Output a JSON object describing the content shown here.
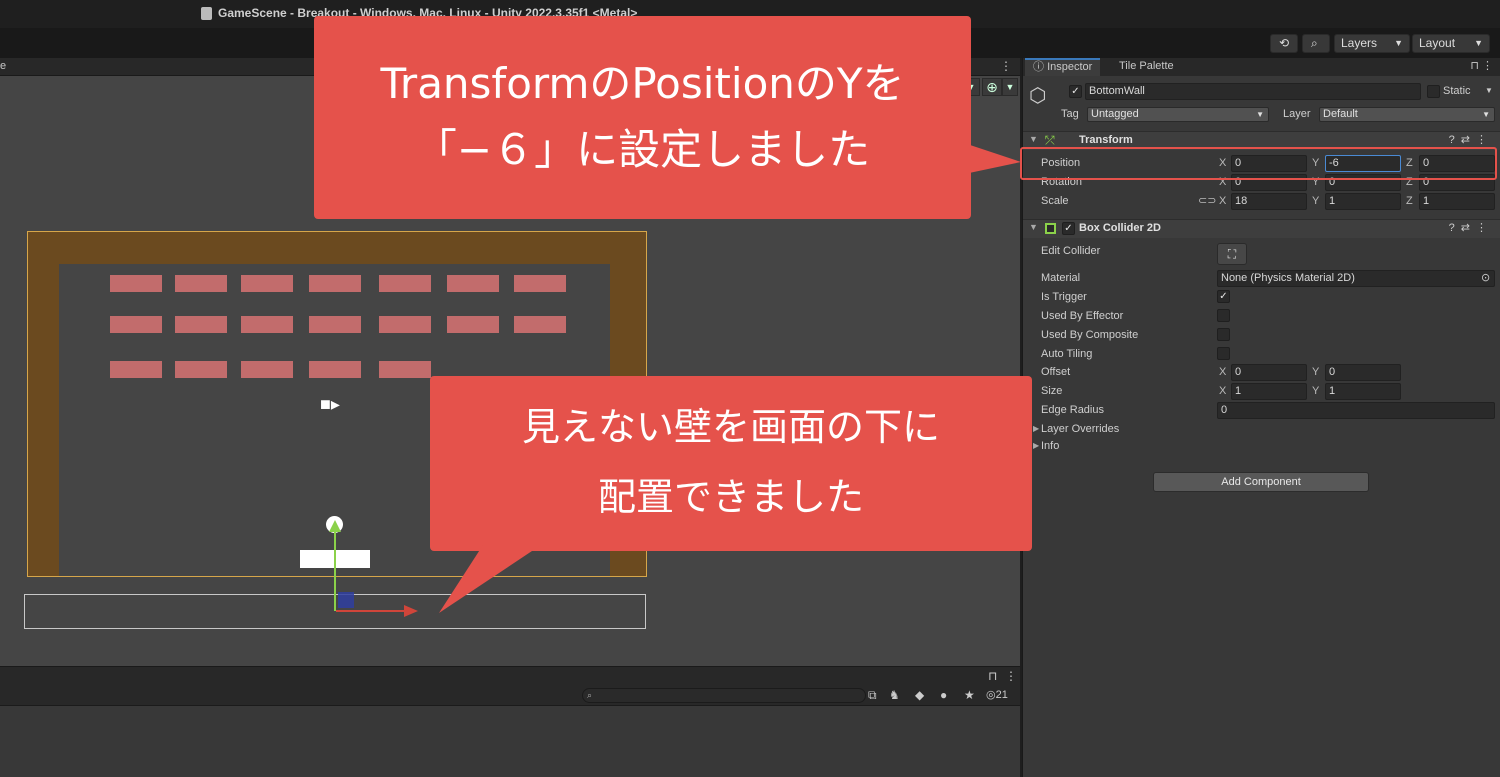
{
  "window": {
    "title": "GameScene - Breakout - Windows, Mac, Linux - Unity 2022.3.35f1 <Metal>"
  },
  "toolbar": {
    "layers_label": "Layers",
    "layout_label": "Layout"
  },
  "scene": {
    "tab_label": "e"
  },
  "inspector": {
    "tabs": [
      "Inspector",
      "Tile Palette"
    ],
    "object_name": "BottomWall",
    "static_label": "Static",
    "tag_label": "Tag",
    "tag_value": "Untagged",
    "layer_label": "Layer",
    "layer_value": "Default",
    "transform": {
      "title": "Transform",
      "position_label": "Position",
      "rotation_label": "Rotation",
      "scale_label": "Scale",
      "position": {
        "x": "0",
        "y": "-6",
        "z": "0"
      },
      "rotation": {
        "x": "0",
        "y": "0",
        "z": "0"
      },
      "scale": {
        "x": "18",
        "y": "1",
        "z": "1"
      }
    },
    "box_collider": {
      "title": "Box Collider 2D",
      "edit_collider": "Edit Collider",
      "material_label": "Material",
      "material_value": "None (Physics Material 2D)",
      "is_trigger": "Is Trigger",
      "used_by_effector": "Used By Effector",
      "used_by_composite": "Used By Composite",
      "auto_tiling": "Auto Tiling",
      "offset_label": "Offset",
      "offset": {
        "x": "0",
        "y": "0"
      },
      "size_label": "Size",
      "size": {
        "x": "1",
        "y": "1"
      },
      "edge_radius_label": "Edge Radius",
      "edge_radius": "0",
      "layer_overrides": "Layer Overrides",
      "info": "Info"
    },
    "add_component": "Add Component"
  },
  "project": {
    "hidden_count": "21"
  },
  "callouts": {
    "top_line1": "TransformのPositionのYを",
    "top_line2": "「−６」に設定しました",
    "bottom_line1": "見えない壁を画面の下に",
    "bottom_line2": "配置できました"
  },
  "colors": {
    "callout": "#e5524b",
    "wall": "#6b4a1f",
    "brick": "#c26c6c",
    "scene_bg": "#454545"
  }
}
